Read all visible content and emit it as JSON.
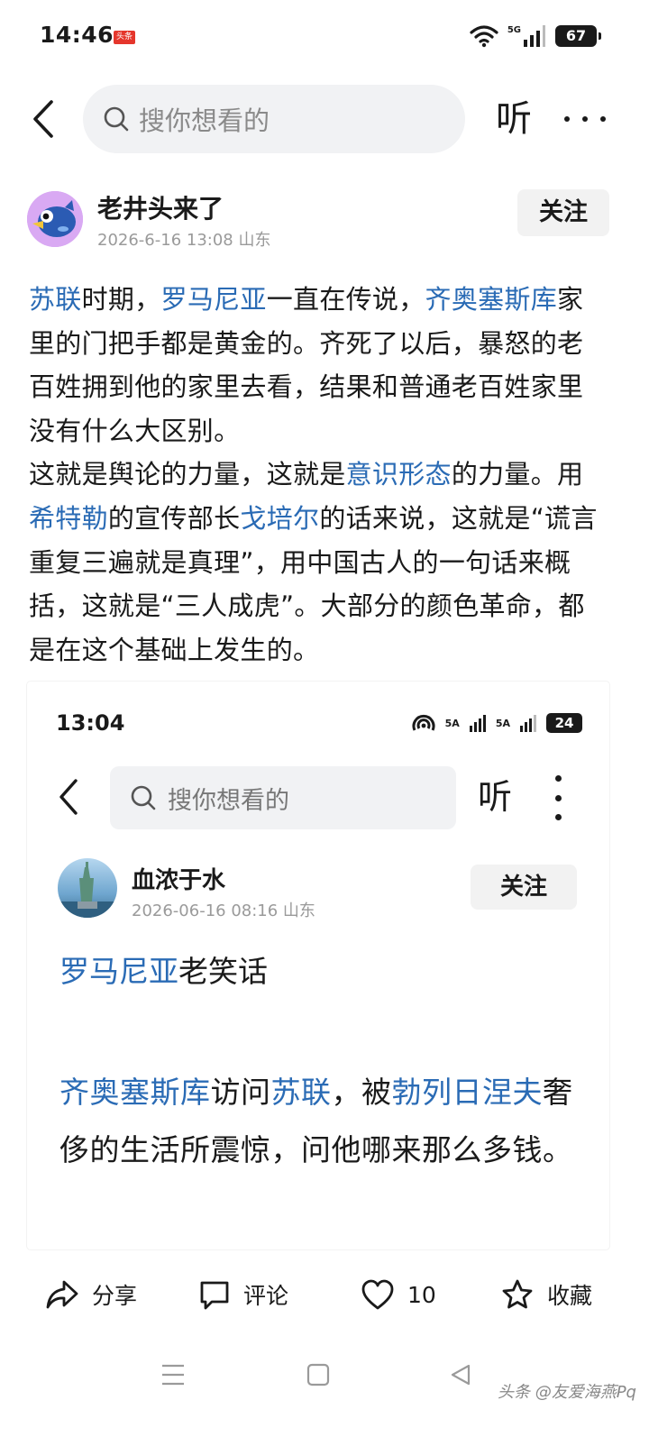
{
  "status_bar": {
    "time": "14:46",
    "app_badge": "头条",
    "network": "5G",
    "battery": "67"
  },
  "top_nav": {
    "search_placeholder": "搜你想看的",
    "listen_label": "听"
  },
  "author": {
    "name": "老井头来了",
    "meta": "2026-6-16 13:08  山东",
    "follow_label": "关注"
  },
  "article": {
    "p1": {
      "link_soviet": "苏联",
      "t1": "时期，",
      "link_romania": "罗马尼亚",
      "t2": "一直在传说，",
      "link_ceausescu": "齐奥塞斯库",
      "t3": "家里的门把手都是黄金的。齐死了以后，暴怒的老百姓拥到他的家里去看，结果和普通老百姓家里没有什么大区别。"
    },
    "p2": {
      "t1": "这就是舆论的力量，这就是",
      "link_ideology": "意识形态",
      "t2": "的力量。用",
      "link_hitler": "希特勒",
      "t3": "的宣传部长",
      "link_goebbels": "戈培尔",
      "t4": "的话来说，这就是“谎言重复三遍就是真理”，用中国古人的一句话来概括，这就是“三人成虎”。大部分的颜色革命，都是在这个基础上发生的。"
    }
  },
  "embedded": {
    "time": "13:04",
    "network_1": "5A",
    "network_2": "5A",
    "battery": "24",
    "search_placeholder": "搜你想看的",
    "listen_label": "听",
    "author_name": "血浓于水",
    "author_meta": "2026-06-16 08:16  山东",
    "follow_label": "关注",
    "heading_link": "罗马尼亚",
    "heading_text": "老笑话",
    "body": {
      "link_ceausescu": "齐奥塞斯库",
      "t1": "访问",
      "link_soviet": "苏联",
      "t2": "，被",
      "link_brezhnev": "勃列日涅夫",
      "t3": "奢侈的生活所震惊，问他哪来那么多钱。"
    }
  },
  "actions": {
    "share": "分享",
    "comment": "评论",
    "like_count": "10",
    "favorite": "收藏"
  },
  "watermark": "头条 @友爱海燕Pq",
  "colors": {
    "link": "#2a6bb5",
    "follow_bg": "#f2f2f2",
    "search_bg": "#f1f2f4"
  }
}
